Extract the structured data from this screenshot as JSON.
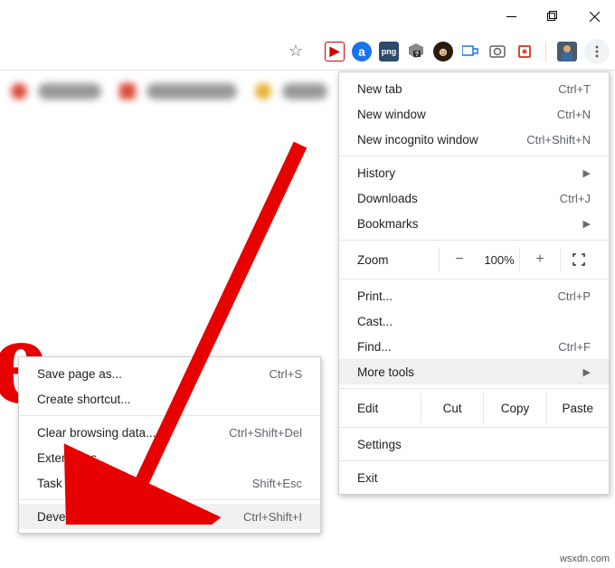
{
  "window": {
    "minimize": "–",
    "maximize": "▢",
    "close": "✕"
  },
  "toolbar": {
    "star": "☆",
    "avatar_color": "#6aa0d8"
  },
  "menu": {
    "new_tab": "New tab",
    "new_tab_sc": "Ctrl+T",
    "new_window": "New window",
    "new_window_sc": "Ctrl+N",
    "incognito": "New incognito window",
    "incognito_sc": "Ctrl+Shift+N",
    "history": "History",
    "downloads": "Downloads",
    "downloads_sc": "Ctrl+J",
    "bookmarks": "Bookmarks",
    "zoom_label": "Zoom",
    "zoom_minus": "−",
    "zoom_pct": "100%",
    "zoom_plus": "+",
    "print": "Print...",
    "print_sc": "Ctrl+P",
    "cast": "Cast...",
    "find": "Find...",
    "find_sc": "Ctrl+F",
    "more_tools": "More tools",
    "edit": "Edit",
    "cut": "Cut",
    "copy": "Copy",
    "paste": "Paste",
    "settings": "Settings",
    "exit": "Exit"
  },
  "submenu": {
    "save_as": "Save page as...",
    "save_as_sc": "Ctrl+S",
    "create_shortcut": "Create shortcut...",
    "clear_data": "Clear browsing data...",
    "clear_data_sc": "Ctrl+Shift+Del",
    "extensions": "Extensions",
    "task_manager": "Task manager",
    "task_manager_sc": "Shift+Esc",
    "dev_tools": "Developer tools",
    "dev_tools_sc": "Ctrl+Shift+I"
  },
  "watermark": "wsxdn.com"
}
